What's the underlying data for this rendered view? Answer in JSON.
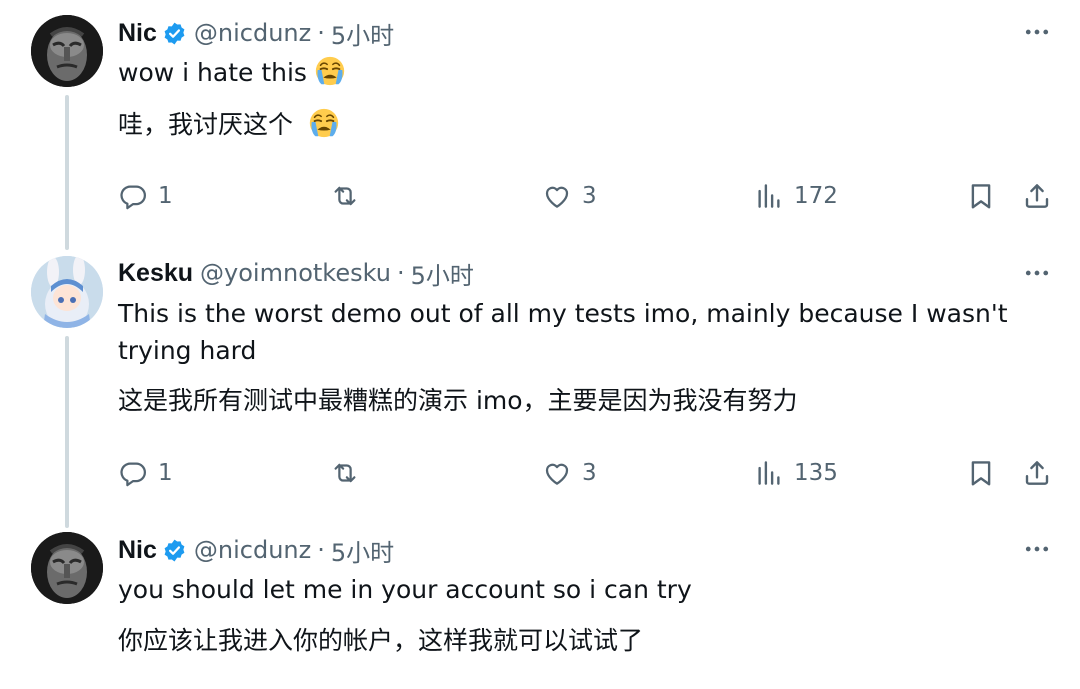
{
  "colors": {
    "text": "#0f1419",
    "muted": "#536471",
    "verified": "#1d9bf0",
    "thread_line": "#cfd9de"
  },
  "tweets": [
    {
      "name": "Nic",
      "verified": true,
      "handle": "@nicdunz",
      "separator": "·",
      "time": "5小时",
      "text_en": "wow i hate this",
      "text_zh": "哇，我讨厌这个",
      "emoji": "loudly-crying-face",
      "actions": {
        "replies": "1",
        "reposts": "",
        "likes": "3",
        "views": "172"
      }
    },
    {
      "name": "Kesku",
      "verified": false,
      "handle": "@yoimnotkesku",
      "separator": "·",
      "time": "5小时",
      "text_en_line1": "This is the worst demo out of all my tests imo, mainly because I wasn't",
      "text_en_line2": "trying hard",
      "text_zh": "这是我所有测试中最糟糕的演示 imo，主要是因为我没有努力",
      "actions": {
        "replies": "1",
        "reposts": "",
        "likes": "3",
        "views": "135"
      }
    },
    {
      "name": "Nic",
      "verified": true,
      "handle": "@nicdunz",
      "separator": "·",
      "time": "5小时",
      "text_en": "you should let me in your account so i can try",
      "text_zh": "你应该让我进入你的帐户，这样我就可以试试了"
    }
  ],
  "icons": [
    "more-icon",
    "reply-icon",
    "repost-icon",
    "like-icon",
    "views-icon",
    "bookmark-icon",
    "share-icon",
    "verified-badge-icon"
  ]
}
